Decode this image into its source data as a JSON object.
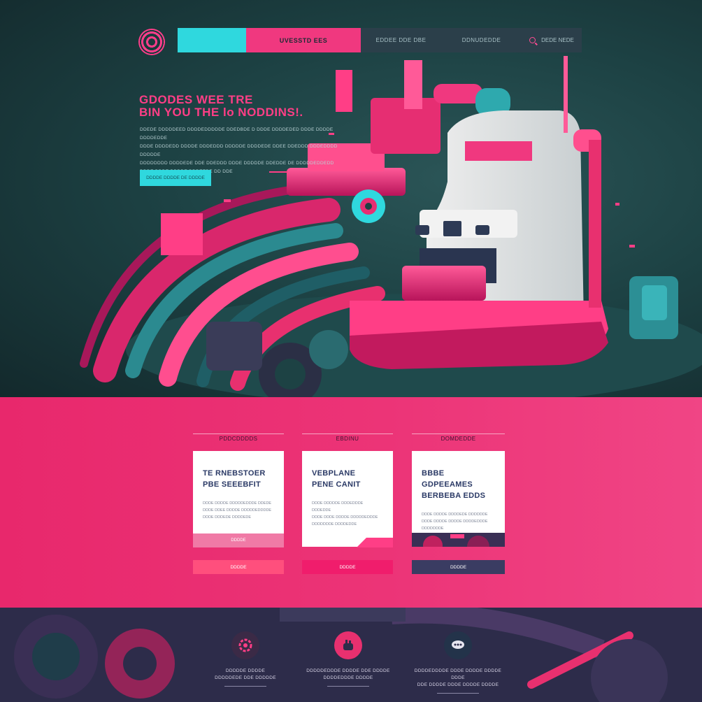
{
  "nav": {
    "primary_label": "UVESSTD EES",
    "links": [
      "EDDEE DDE DBE",
      "DDNUDEDDE"
    ],
    "search_label": "DEDE NEDE"
  },
  "hero": {
    "title_line1": "GDODES  WEE TRE",
    "title_line2": "BIN YOU THE lo NODDINS!.",
    "body_lines": [
      "DDEDE  DDDDDEED DDDDEDDDDDE DDEDBDE D DDDE DDDDEDED DDDE DDDDE DDDDEDDE",
      "DDDE DDDDEDD DDDDE DDDEDDD DDDDDE DDDDEDE DDEE DDEDDD DDDEDDDD DDDDDE",
      "DDDDDDDD DDDDEDE DDE DDEDDD DDDE DDDDDE DDEDDE DE DDDDDEDDEDD",
      "DDDE DDDE DDDDE DDDEEDE DD DDE"
    ],
    "cta_label": "DDDDE DDDDE DE DDDDE"
  },
  "services": [
    {
      "tag": "PDDCDDDDS",
      "title": [
        "TE RNEBSTOER",
        "PBE SEEEBFIT"
      ],
      "text": [
        "DDDE DDDDE DDDDDEDDDE DDEDE",
        "DDDE DDEE DDDDE DDDDDEDDDDE",
        "DDDE DDDEDE DDDDEDE"
      ],
      "footer": "DDDDE",
      "button": "DDDDE"
    },
    {
      "tag": "EBDINU",
      "title": [
        "VEBPLANE",
        "PENE CANIT"
      ],
      "text": [
        "DDDE DDDDDE DDDEDDDE DDDEDDE",
        "DDDE DDDE DDDDE DDDDDEDDDE",
        "DDDDDDDE DDDDEDDE"
      ],
      "footer": "",
      "button": "DDDDE"
    },
    {
      "tag": "DOMDEDDE",
      "title": [
        "BBBE GDPEEAMES",
        "BERBEBA EDDS"
      ],
      "text": [
        "DDDE DDDDE DDDDEDE DDDDDDE",
        "DDDE DDDDE DDDDE DDDDEDDDE",
        "DDDDDDDE"
      ],
      "footer": "",
      "button": "DDDDE"
    }
  ],
  "features": [
    {
      "line1": "DDDDDE DDDDE",
      "line2": "DDDDDEDE DDE DDDDDE"
    },
    {
      "line1": "DDDDDEDDDE DDDDE DDE DDDDE",
      "line2": "DDDDEDDDE DDDDE"
    },
    {
      "line1": "DDDDEDDDDE DDDE DDDDE DDDDE DDDE",
      "line2": "DDE DDDDE DDDE DDDDE DDDDE"
    }
  ],
  "colors": {
    "accent_pink": "#f0387f",
    "accent_cyan": "#2fd8de",
    "hero_bg": "#1d4244",
    "navy": "#2d2c4a"
  },
  "icons": [
    "target-logo-icon",
    "search-icon",
    "gear-icon",
    "hand-icon",
    "chat-icon"
  ]
}
